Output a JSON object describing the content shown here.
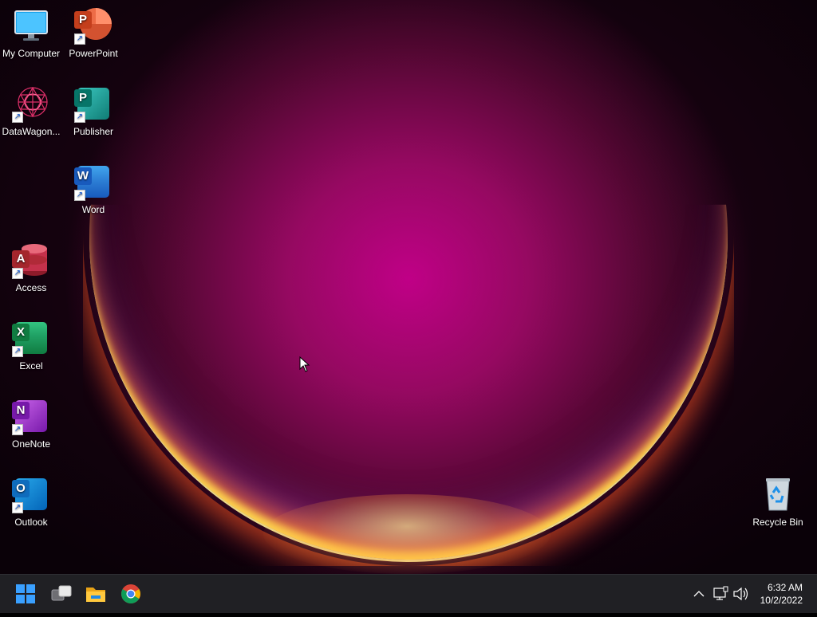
{
  "desktop_icons": {
    "my_computer": "My Computer",
    "powerpoint": "PowerPoint",
    "datawagon": "DataWagon...",
    "publisher": "Publisher",
    "word": "Word",
    "access": "Access",
    "excel": "Excel",
    "onenote": "OneNote",
    "outlook": "Outlook",
    "recycle_bin": "Recycle Bin"
  },
  "app_letters": {
    "powerpoint": "P",
    "publisher": "P",
    "word": "W",
    "access": "A",
    "excel": "X",
    "onenote": "N",
    "outlook": "O"
  },
  "taskbar": {
    "clock_time": "6:32 AM",
    "clock_date": "10/2/2022"
  },
  "colors": {
    "taskbar_bg": "#202024",
    "accent": "#3aa0ff"
  }
}
